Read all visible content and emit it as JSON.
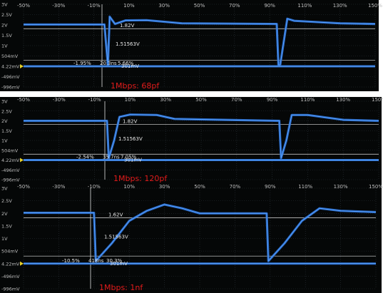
{
  "chart_data": [
    {
      "type": "line",
      "caption": "1Mbps: 68pf",
      "x_ticks": [
        "-50%",
        "-30%",
        "-10%",
        "10%",
        "30%",
        "50%",
        "70%",
        "90%",
        "110%",
        "130%",
        "150%"
      ],
      "y_ticks": [
        "3V",
        "2.5V",
        "2V",
        "1.5V",
        "1V",
        "504mV",
        "4.22mV",
        "-496mV",
        "-996mV"
      ],
      "annotations": {
        "high_level": "1.82V",
        "mid_level": "1.51563V",
        "low_level": "301mV",
        "left_pct": "-1.95%",
        "width": "20.3ns",
        "right_pct": "5.66%"
      },
      "series": [
        {
          "values": [
            [
              -50,
              2.02
            ],
            [
              -4,
              2.02
            ],
            [
              -2,
              0.05
            ],
            [
              -1,
              2.4
            ],
            [
              2,
              2.05
            ],
            [
              8,
              2.22
            ],
            [
              20,
              2.23
            ],
            [
              40,
              2.08
            ],
            [
              94,
              2.05
            ],
            [
              95,
              0.05
            ],
            [
              96,
              0.08
            ],
            [
              100,
              2.3
            ],
            [
              104,
              2.2
            ],
            [
              130,
              2.08
            ],
            [
              150,
              2.05
            ]
          ]
        }
      ]
    },
    {
      "type": "line",
      "caption": "1Mbps: 120pf",
      "x_ticks": [
        "-50%",
        "-30%",
        "-10%",
        "10%",
        "30%",
        "50%",
        "70%",
        "90%",
        "110%",
        "130%",
        "150%"
      ],
      "y_ticks": [
        "3V",
        "2.5V",
        "2V",
        "1.5V",
        "1V",
        "504mV",
        "4.22mV",
        "-496mV",
        "-996mV"
      ],
      "annotations": {
        "high_level": "1.82V",
        "mid_level": "1.51563V",
        "low_level": "301mV",
        "left_pct": "-2.54%",
        "width": "35.7ns",
        "right_pct": "7.05%"
      },
      "series": [
        {
          "values": [
            [
              -50,
              2.0
            ],
            [
              -3,
              2.0
            ],
            [
              -2,
              0.1
            ],
            [
              1,
              1.0
            ],
            [
              4,
              2.2
            ],
            [
              10,
              2.32
            ],
            [
              25,
              2.3
            ],
            [
              35,
              2.1
            ],
            [
              94,
              2.0
            ],
            [
              95,
              0.1
            ],
            [
              98,
              1.0
            ],
            [
              101,
              2.3
            ],
            [
              110,
              2.3
            ],
            [
              130,
              2.05
            ],
            [
              150,
              2.0
            ]
          ]
        }
      ]
    },
    {
      "type": "line",
      "caption": "1Mbps: 1nf",
      "x_ticks": [
        "-50%",
        "-30%",
        "-10%",
        "10%",
        "30%",
        "50%",
        "70%",
        "90%",
        "110%",
        "130%",
        "150%"
      ],
      "y_ticks": [
        "3V",
        "2.5V",
        "2V",
        "1.5V",
        "1V",
        "504mV",
        "4.22mV",
        "-496mV",
        "-996mV"
      ],
      "annotations": {
        "high_level": "1.62V",
        "mid_level": "1.51563V",
        "low_level": "301mV",
        "left_pct": "-10.5%",
        "width": "418ns",
        "right_pct": "30.3%"
      },
      "series": [
        {
          "values": [
            [
              -50,
              2.02
            ],
            [
              -10,
              2.02
            ],
            [
              -9,
              0.1
            ],
            [
              0,
              0.8
            ],
            [
              10,
              1.7
            ],
            [
              20,
              2.1
            ],
            [
              30,
              2.35
            ],
            [
              40,
              2.2
            ],
            [
              50,
              2.0
            ],
            [
              88,
              2.0
            ],
            [
              89,
              0.1
            ],
            [
              98,
              0.8
            ],
            [
              108,
              1.7
            ],
            [
              118,
              2.2
            ],
            [
              130,
              2.1
            ],
            [
              150,
              2.05
            ]
          ]
        }
      ]
    }
  ]
}
